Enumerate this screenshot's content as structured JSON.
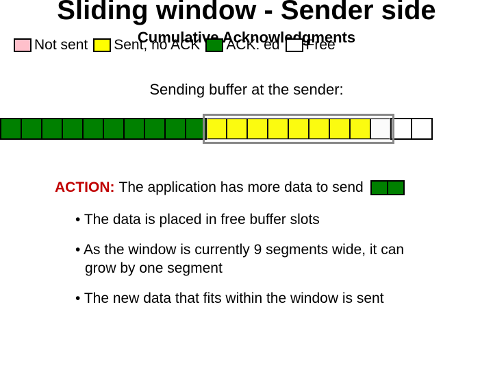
{
  "title": "Sliding window - Sender side",
  "subtitle": "Cumulative Acknowledgments",
  "legend": {
    "not_sent": "Not sent",
    "sent_no_ack": "Sent, no ACK",
    "acked": "ACK: ed",
    "free": "Free"
  },
  "buffer_caption": "Sending buffer at the sender:",
  "action": {
    "label": "ACTION",
    "text": "The application has more data to send"
  },
  "bullets": [
    "The data is placed in free buffer slots",
    "As the window is currently 9 segments wide, it can grow by one segment",
    "The new data that fits within the window is sent"
  ],
  "chart_data": {
    "type": "table",
    "description": "Sender buffer slots left-to-right with sliding window overlay",
    "slots": [
      "acked",
      "acked",
      "acked",
      "acked",
      "acked",
      "acked",
      "acked",
      "acked",
      "acked",
      "acked",
      "sent_no_ack",
      "sent_no_ack",
      "sent_no_ack",
      "sent_no_ack",
      "sent_no_ack",
      "sent_no_ack",
      "sent_no_ack",
      "sent_no_ack",
      "free",
      "free",
      "free"
    ],
    "window": {
      "start_index": 10,
      "length": 9
    },
    "new_data_segments": 2,
    "legend_colors": {
      "not_sent": "#ffc0cb",
      "sent_no_ack": "#ffff00",
      "acked": "#008000",
      "free": "#ffffff"
    }
  }
}
